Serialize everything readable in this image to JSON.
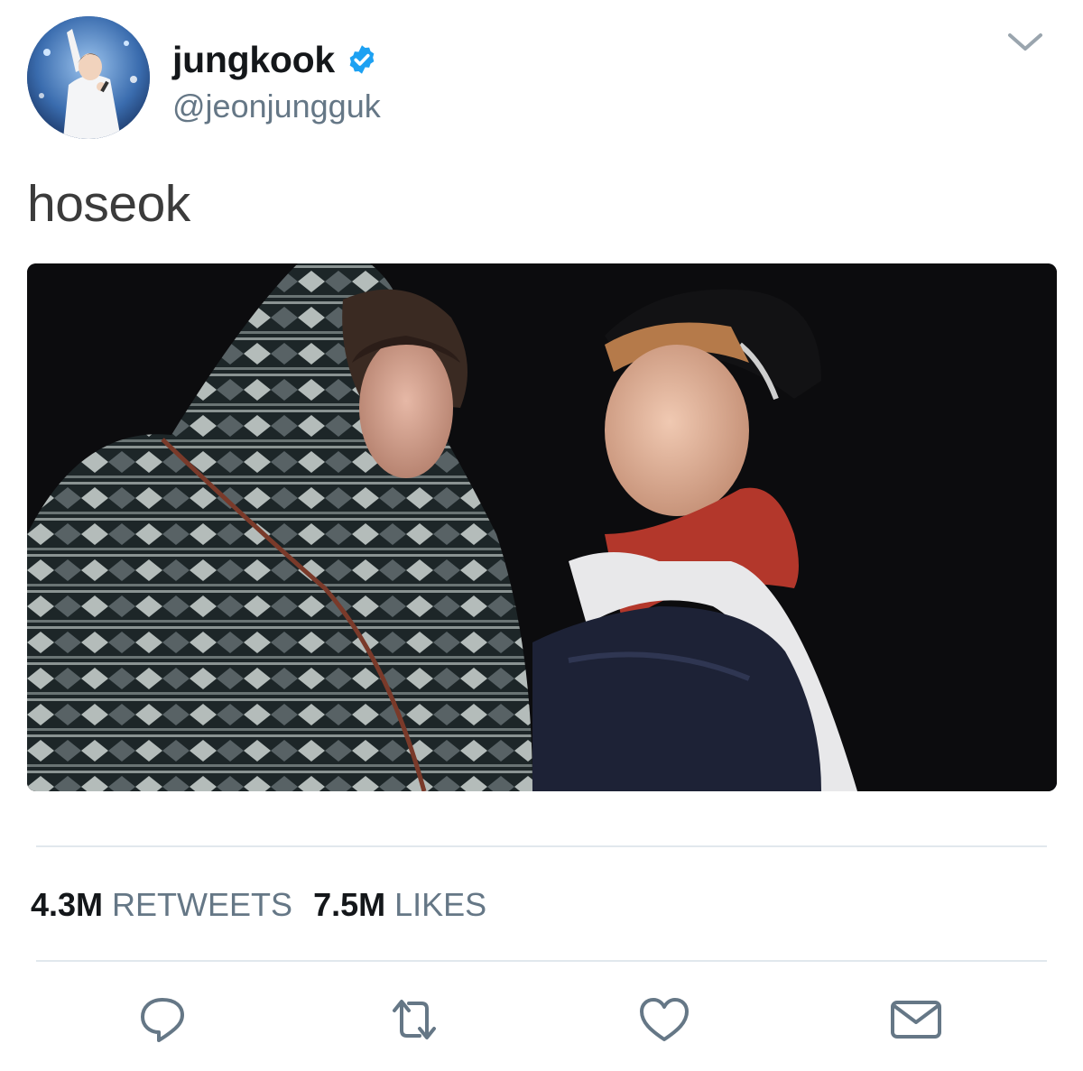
{
  "tweet": {
    "author": {
      "display_name": "jungkook",
      "handle": "@jeonjungguk",
      "verified": true
    },
    "text": "hoseok",
    "stats": {
      "retweets_count": "4.3M",
      "retweets_label": "RETWEETS",
      "likes_count": "7.5M",
      "likes_label": "LIKES"
    },
    "actions": [
      "reply-icon",
      "retweet-icon",
      "like-icon",
      "direct-message-icon"
    ]
  },
  "colors": {
    "text_primary": "#14171a",
    "text_secondary": "#657786",
    "verified_blue": "#1da1f2",
    "icon_gray": "#657786",
    "divider": "#e1e8ed"
  }
}
